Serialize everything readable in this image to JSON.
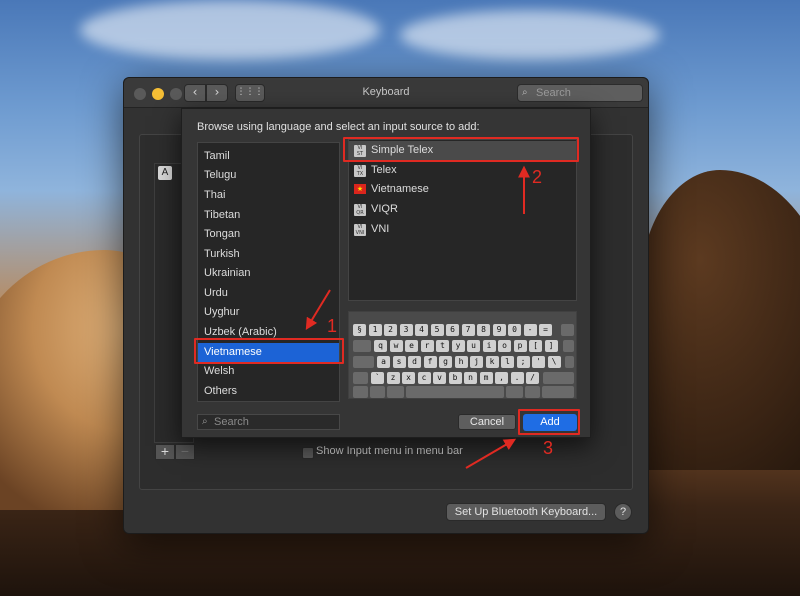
{
  "window": {
    "title": "Keyboard",
    "search_placeholder": "Search",
    "nav_back": "‹",
    "nav_forward": "›",
    "grid": "⋮⋮⋮",
    "background_list_badge": "A",
    "show_input_menu_label": "Show Input menu in menu bar",
    "bluetooth_button": "Set Up Bluetooth Keyboard...",
    "help_button": "?",
    "plus": "+",
    "minus": "−"
  },
  "sheet": {
    "title": "Browse using language and select an input source to add:",
    "languages": [
      "Tamil",
      "Telugu",
      "Thai",
      "Tibetan",
      "Tongan",
      "Turkish",
      "Ukrainian",
      "Urdu",
      "Uyghur",
      "Uzbek (Arabic)",
      "Vietnamese",
      "Welsh",
      "Others"
    ],
    "selected_language": "Vietnamese",
    "sources": [
      {
        "label": "Simple Telex",
        "icon": "vi-st-icon",
        "badge": "VI ST"
      },
      {
        "label": "Telex",
        "icon": "vi-tx-icon",
        "badge": "VI TX"
      },
      {
        "label": "Vietnamese",
        "icon": "vietnam-flag-icon",
        "badge": "★"
      },
      {
        "label": "VIQR",
        "icon": "vi-qr-icon",
        "badge": "VI QR"
      },
      {
        "label": "VNI",
        "icon": "vi-vni-icon",
        "badge": "VI VNI"
      }
    ],
    "selected_source": "Simple Telex",
    "keyboard_rows": [
      [
        "§",
        "1",
        "2",
        "3",
        "4",
        "5",
        "6",
        "7",
        "8",
        "9",
        "0",
        "-",
        "="
      ],
      [
        "q",
        "w",
        "e",
        "r",
        "t",
        "y",
        "u",
        "i",
        "o",
        "p",
        "[",
        "]"
      ],
      [
        "a",
        "s",
        "d",
        "f",
        "g",
        "h",
        "j",
        "k",
        "l",
        ";",
        "'",
        "\\"
      ],
      [
        "`",
        "z",
        "x",
        "c",
        "v",
        "b",
        "n",
        "m",
        ",",
        ".",
        "/"
      ]
    ],
    "search_placeholder": "Search",
    "cancel_label": "Cancel",
    "add_label": "Add"
  },
  "annotations": {
    "step1": "1",
    "step2": "2",
    "step3": "3",
    "color": "#e02a22"
  },
  "colors": {
    "selection_blue": "#1c63d6",
    "add_button": "#1f6de4",
    "window_bg": "#323232"
  }
}
